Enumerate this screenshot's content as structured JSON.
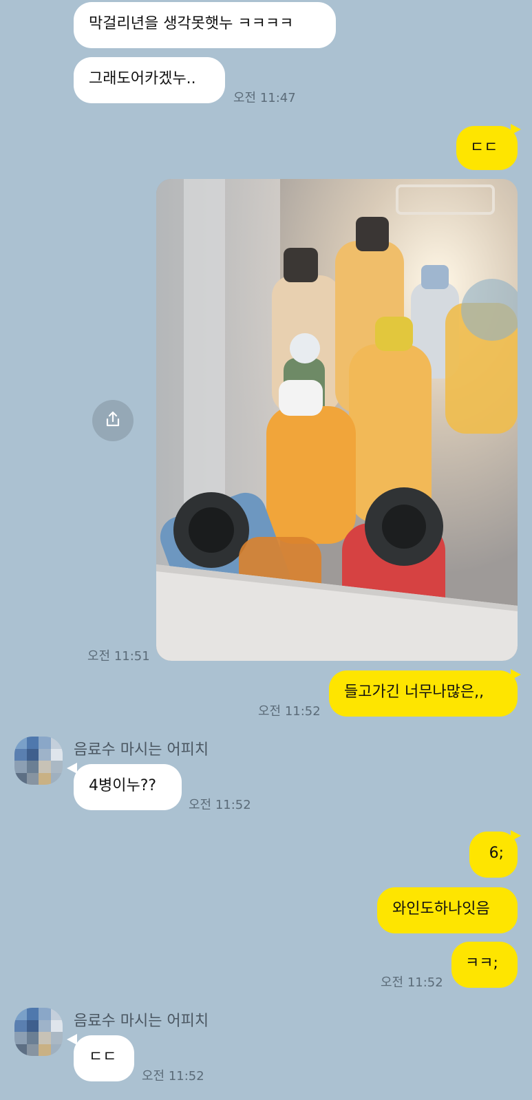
{
  "sender_name": "음료수 마시는 어피치",
  "messages": {
    "m1": {
      "text": "막걸리년을 생각못햇누 ㅋㅋㅋㅋ"
    },
    "m2": {
      "text": "그래도어카겠누..",
      "time": "오전 11:47"
    },
    "m3": {
      "text": "ㄷㄷ"
    },
    "m4": {
      "time": "오전 11:51"
    },
    "m5": {
      "text": "들고가긴 너무나많은,,",
      "time": "오전 11:52"
    },
    "m6": {
      "text": "4병이누??",
      "time": "오전 11:52"
    },
    "m7": {
      "text": "6;"
    },
    "m8": {
      "text": "와인도하나잇음"
    },
    "m9": {
      "text": "ㅋㅋ;",
      "time": "오전 11:52"
    },
    "m10": {
      "text": "ㄷㄷ",
      "time": "오전 11:52"
    }
  },
  "icons": {
    "share": "share-icon",
    "avatar": "avatar-icon"
  },
  "colors": {
    "background": "#abc1d1",
    "outgoing_bubble": "#fee500",
    "incoming_bubble": "#ffffff"
  }
}
